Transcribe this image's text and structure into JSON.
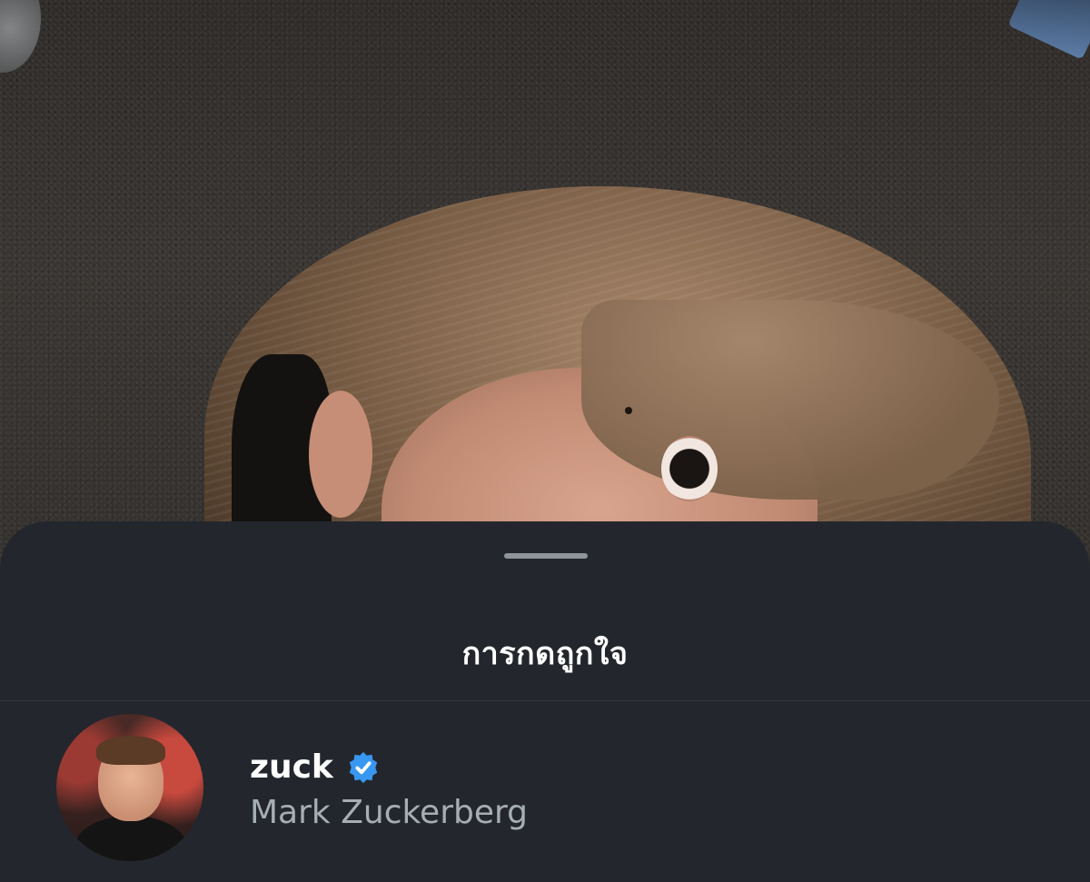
{
  "sheet": {
    "title": "การกดถูกใจ"
  },
  "likes": [
    {
      "username": "zuck",
      "full_name": "Mark Zuckerberg",
      "verified": true,
      "avatar_icon": "user-avatar-photo"
    }
  ],
  "colors": {
    "sheet_background": "#23272d",
    "verified_badge": "#3897f0",
    "secondary_text": "#a7adb5",
    "primary_text": "#ffffff"
  }
}
